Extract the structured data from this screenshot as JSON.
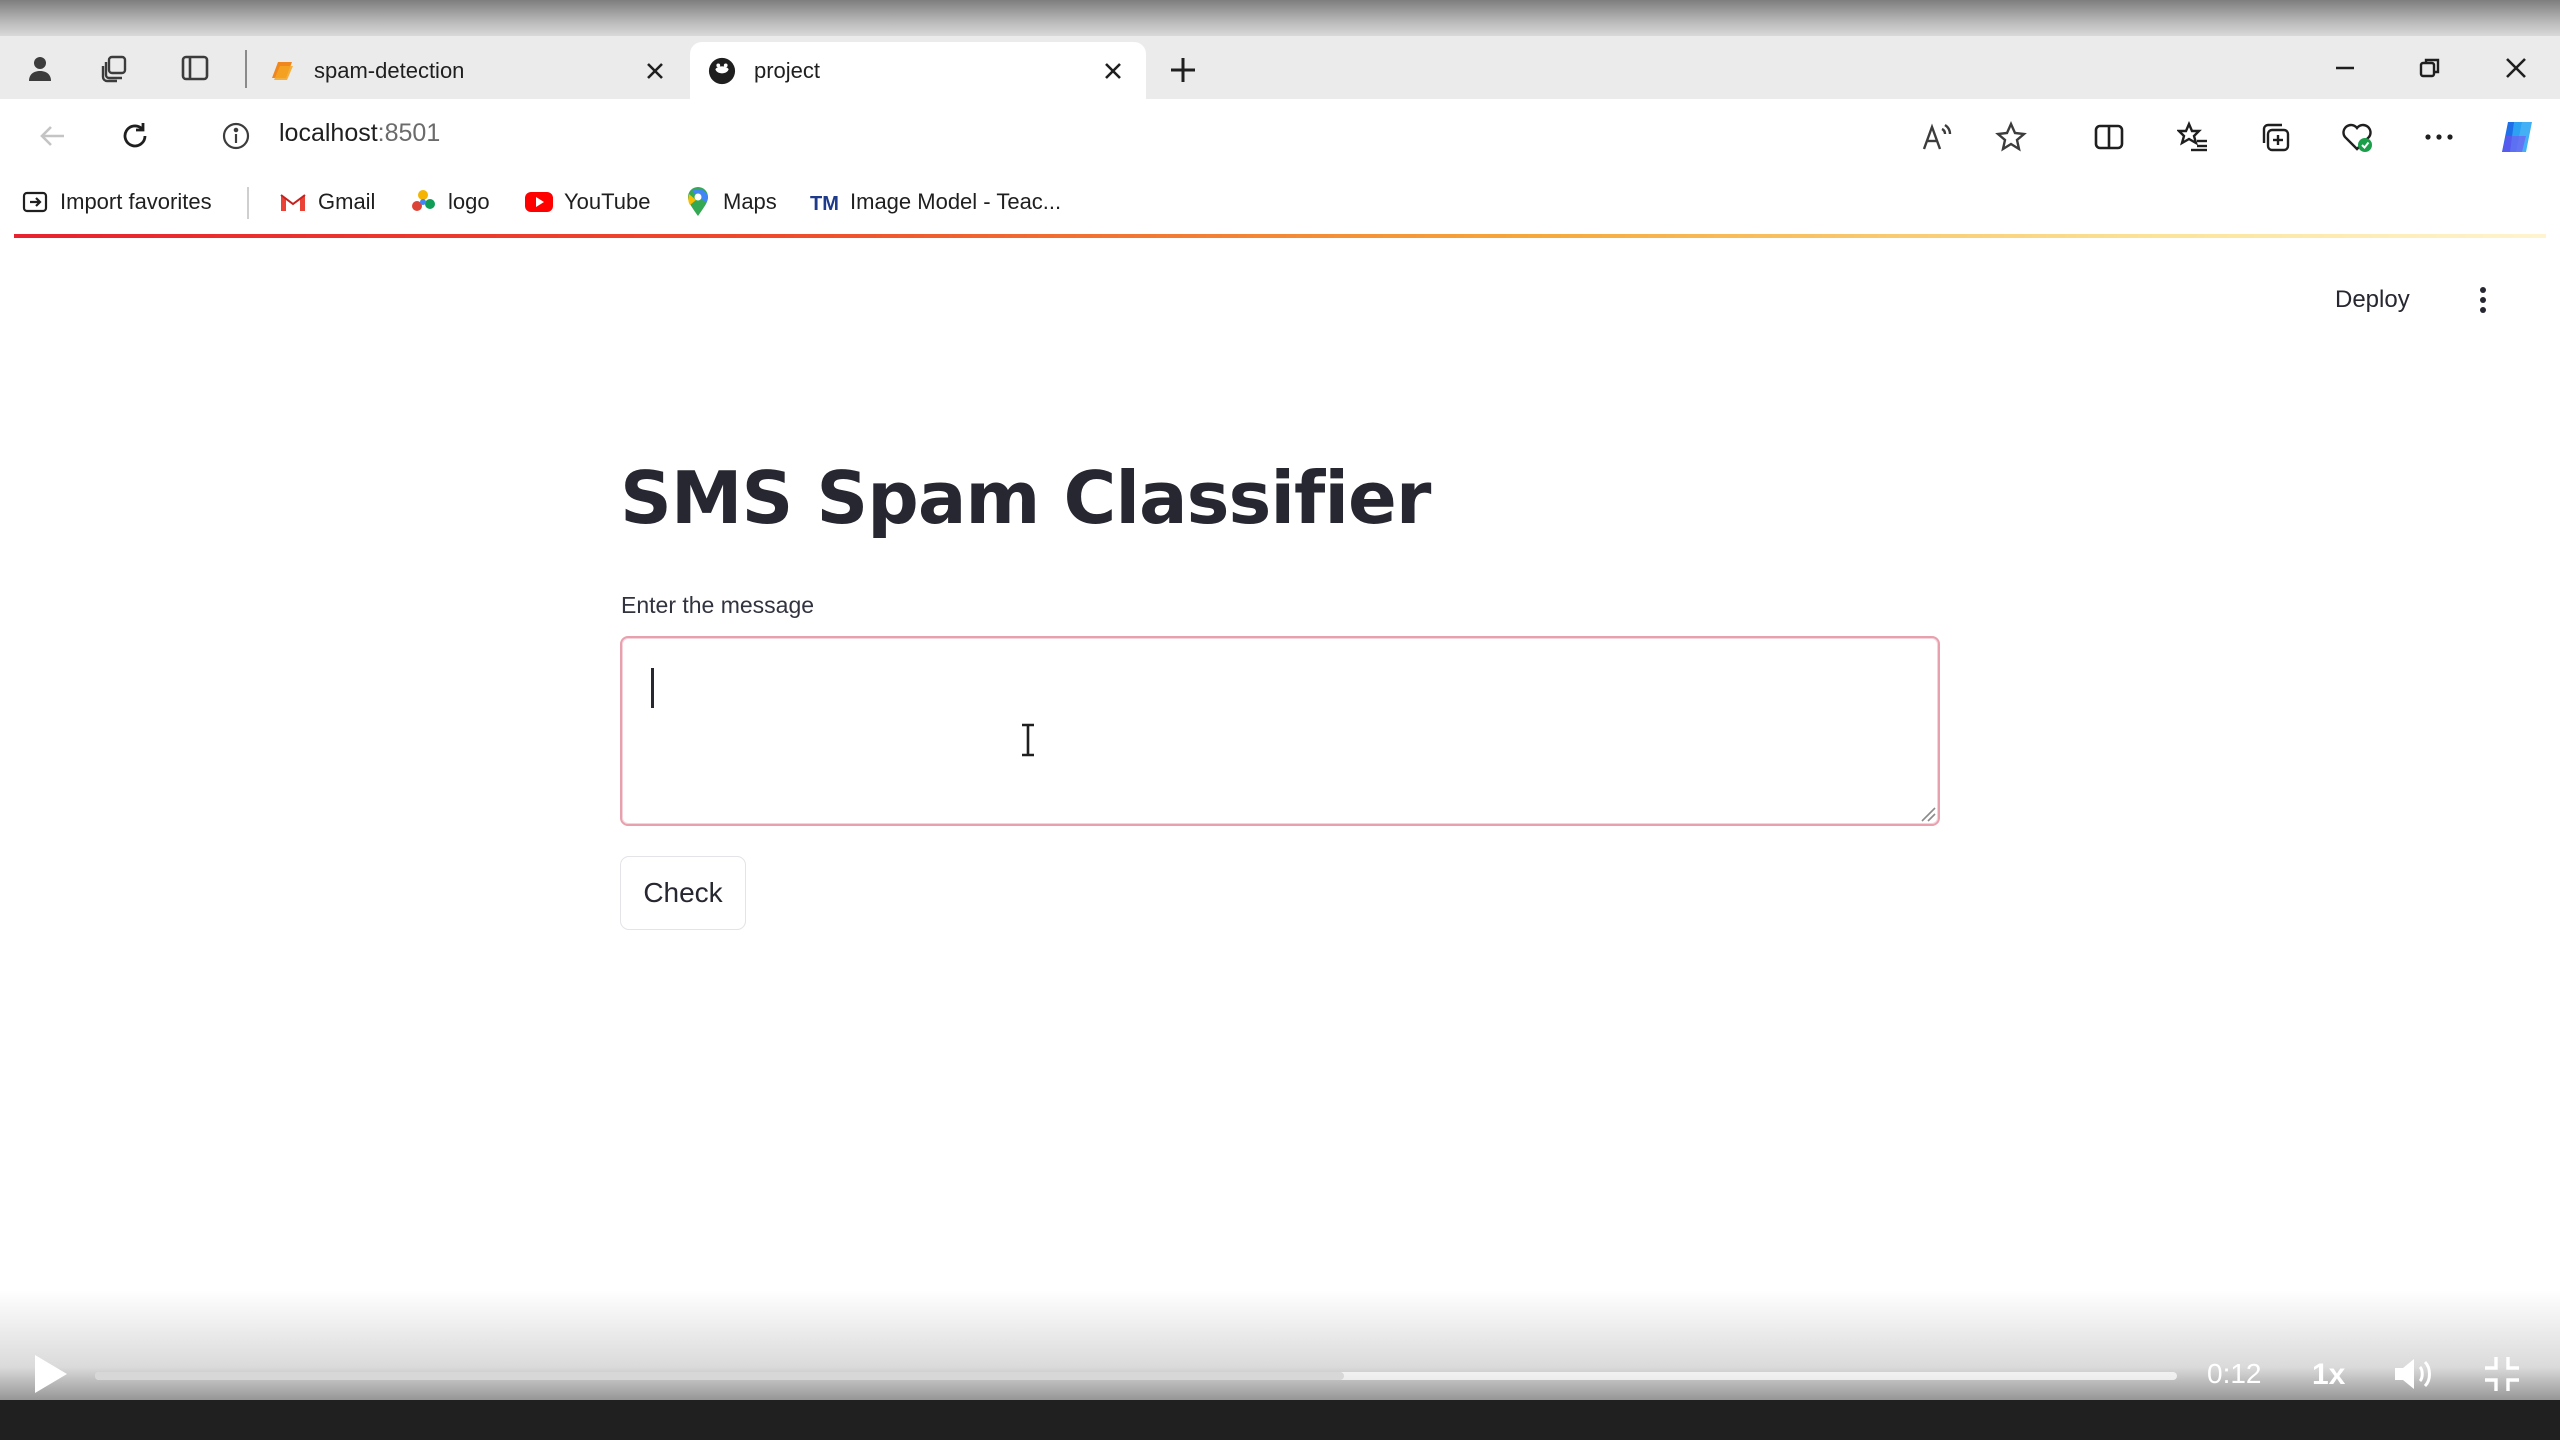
{
  "browser": {
    "tabs": [
      {
        "title": "spam-detection",
        "active": false
      },
      {
        "title": "project",
        "active": true
      }
    ],
    "address": {
      "host": "localhost",
      "port": ":8501"
    },
    "bookmarks": [
      {
        "label": "Import favorites",
        "icon": "import-favorites-icon"
      },
      {
        "label": "Gmail",
        "icon": "gmail-icon"
      },
      {
        "label": "logo",
        "icon": "logo-bookmark-icon"
      },
      {
        "label": "YouTube",
        "icon": "youtube-icon"
      },
      {
        "label": "Maps",
        "icon": "maps-pin-icon"
      },
      {
        "label": "Image Model - Teac...",
        "icon": "teachable-machine-icon"
      }
    ]
  },
  "app": {
    "deploy_label": "Deploy",
    "title": "SMS Spam Classifier",
    "input_label": "Enter the message",
    "input_value": "",
    "button_label": "Check"
  },
  "player": {
    "time": "0:12",
    "speed": "1x",
    "progress": 0.6
  },
  "colors": {
    "accent_red": "#e8222f",
    "input_border": "#e8a0ad",
    "text": "#262730"
  }
}
